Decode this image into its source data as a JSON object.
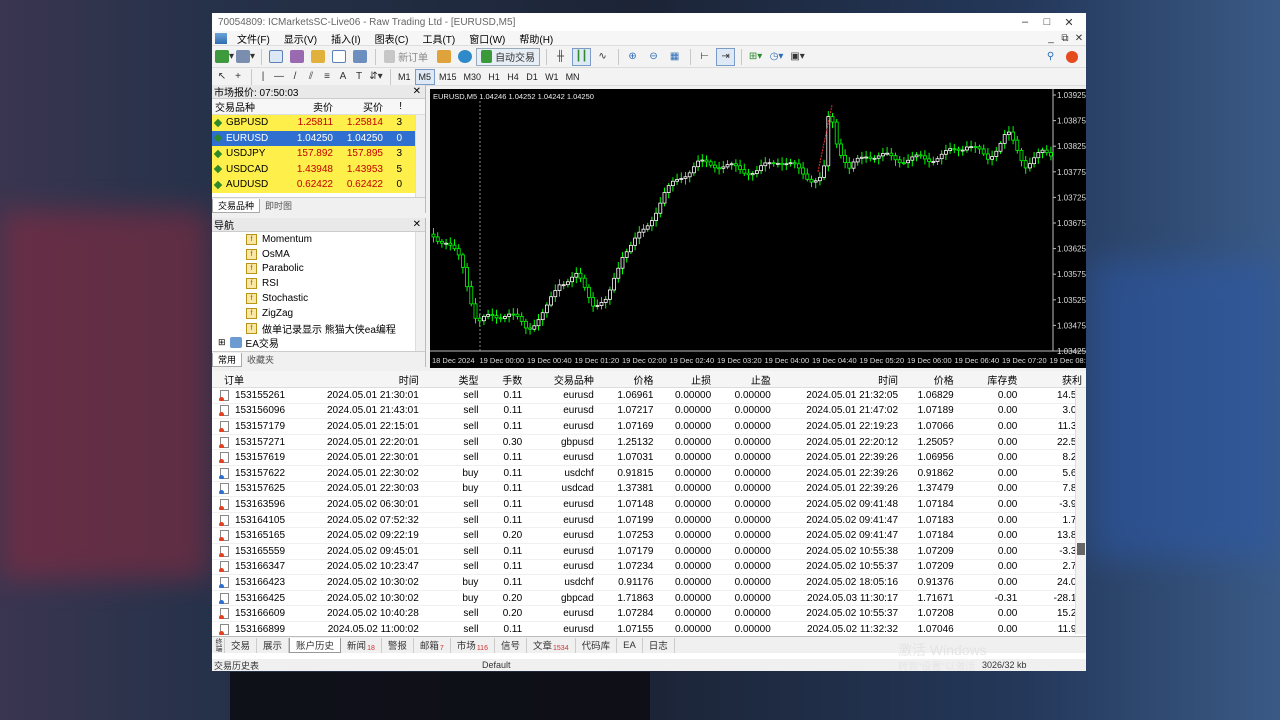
{
  "window": {
    "title": "70054809: ICMarketsSC-Live06 - Raw Trading Ltd - [EURUSD,M5]"
  },
  "menu": [
    "文件(F)",
    "显示(V)",
    "插入(I)",
    "图表(C)",
    "工具(T)",
    "窗口(W)",
    "帮助(H)"
  ],
  "toolbar": {
    "new_order": "新订单",
    "auto_trading": "自动交易",
    "timeframes": [
      "M1",
      "M5",
      "M15",
      "M30",
      "H1",
      "H4",
      "D1",
      "W1",
      "MN"
    ],
    "active_timeframe": "M5"
  },
  "market_watch": {
    "title": "市场报价: 07:50:03",
    "headers": {
      "symbol": "交易品种",
      "bid": "卖价",
      "ask": "买价",
      "spread": "!"
    },
    "rows": [
      {
        "symbol": "GBPUSD",
        "bid": "1.25811",
        "ask": "1.25814",
        "spread": "3"
      },
      {
        "symbol": "EURUSD",
        "bid": "1.04250",
        "ask": "1.04250",
        "spread": "0"
      },
      {
        "symbol": "USDJPY",
        "bid": "157.892",
        "ask": "157.895",
        "spread": "3"
      },
      {
        "symbol": "USDCAD",
        "bid": "1.43948",
        "ask": "1.43953",
        "spread": "5"
      },
      {
        "symbol": "AUDUSD",
        "bid": "0.62422",
        "ask": "0.62422",
        "spread": "0"
      }
    ],
    "tabs": [
      "交易品种",
      "即时图"
    ]
  },
  "navigator": {
    "title": "导航",
    "indicators": [
      "Momentum",
      "OsMA",
      "Parabolic",
      "RSI",
      "Stochastic",
      "ZigZag",
      "做单记录显示 熊猫大侠ea编程"
    ],
    "ea_label": "EA交易",
    "tabs": [
      "常用",
      "收藏夹"
    ]
  },
  "chart": {
    "label": "EURUSD,M5  1.04246 1.04252 1.04242 1.04250",
    "price_levels": [
      "1.03925",
      "1.03875",
      "1.03825",
      "1.03775",
      "1.03725",
      "1.03675",
      "1.03625",
      "1.03575",
      "1.03525",
      "1.03475",
      "1.03425"
    ],
    "time_labels": [
      "18 Dec 2024",
      "19 Dec 00:00",
      "19 Dec 00:40",
      "19 Dec 01:20",
      "19 Dec 02:00",
      "19 Dec 02:40",
      "19 Dec 03:20",
      "19 Dec 04:00",
      "19 Dec 04:40",
      "19 Dec 05:20",
      "19 Dec 06:00",
      "19 Dec 06:40",
      "19 Dec 07:20",
      "19 Dec 08:00"
    ],
    "colors": {
      "background": "#000000",
      "bull": "#ffffff",
      "bear": "#00ff00"
    }
  },
  "history": {
    "headers": [
      "订单",
      "时间",
      "类型",
      "手数",
      "交易品种",
      "价格",
      "止损",
      "止盈",
      "时间",
      "价格",
      "库存费",
      "获利"
    ],
    "rows": [
      [
        "153155261",
        "2024.05.01 21:30:01",
        "sell",
        "0.11",
        "eurusd",
        "1.06961",
        "0.00000",
        "0.00000",
        "2024.05.01 21:32:05",
        "1.06829",
        "0.00",
        "14.52"
      ],
      [
        "153156096",
        "2024.05.01 21:43:01",
        "sell",
        "0.11",
        "eurusd",
        "1.07217",
        "0.00000",
        "0.00000",
        "2024.05.01 21:47:02",
        "1.07189",
        "0.00",
        "3.08"
      ],
      [
        "153157179",
        "2024.05.01 22:15:01",
        "sell",
        "0.11",
        "eurusd",
        "1.07169",
        "0.00000",
        "0.00000",
        "2024.05.01 22:19:23",
        "1.07066",
        "0.00",
        "11.33"
      ],
      [
        "153157271",
        "2024.05.01 22:20:01",
        "sell",
        "0.30",
        "gbpusd",
        "1.25132",
        "0.00000",
        "0.00000",
        "2024.05.01 22:20:12",
        "1.2505?",
        "0.00",
        "22.50"
      ],
      [
        "153157619",
        "2024.05.01 22:30:01",
        "sell",
        "0.11",
        "eurusd",
        "1.07031",
        "0.00000",
        "0.00000",
        "2024.05.01 22:39:26",
        "1.06956",
        "0.00",
        "8.25"
      ],
      [
        "153157622",
        "2024.05.01 22:30:02",
        "buy",
        "0.11",
        "usdchf",
        "0.91815",
        "0.00000",
        "0.00000",
        "2024.05.01 22:39:26",
        "0.91862",
        "0.00",
        "5.63"
      ],
      [
        "153157625",
        "2024.05.01 22:30:03",
        "buy",
        "0.11",
        "usdcad",
        "1.37381",
        "0.00000",
        "0.00000",
        "2024.05.01 22:39:26",
        "1.37479",
        "0.00",
        "7.84"
      ],
      [
        "153163596",
        "2024.05.02 06:30:01",
        "sell",
        "0.11",
        "eurusd",
        "1.07148",
        "0.00000",
        "0.00000",
        "2024.05.02 09:41:48",
        "1.07184",
        "0.00",
        "-3.96"
      ],
      [
        "153164105",
        "2024.05.02 07:52:32",
        "sell",
        "0.11",
        "eurusd",
        "1.07199",
        "0.00000",
        "0.00000",
        "2024.05.02 09:41:47",
        "1.07183",
        "0.00",
        "1.76"
      ],
      [
        "153165165",
        "2024.05.02 09:22:19",
        "sell",
        "0.20",
        "eurusd",
        "1.07253",
        "0.00000",
        "0.00000",
        "2024.05.02 09:41:47",
        "1.07184",
        "0.00",
        "13.80"
      ],
      [
        "153165559",
        "2024.05.02 09:45:01",
        "sell",
        "0.11",
        "eurusd",
        "1.07179",
        "0.00000",
        "0.00000",
        "2024.05.02 10:55:38",
        "1.07209",
        "0.00",
        "-3.30"
      ],
      [
        "153166347",
        "2024.05.02 10:23:47",
        "sell",
        "0.11",
        "eurusd",
        "1.07234",
        "0.00000",
        "0.00000",
        "2024.05.02 10:55:37",
        "1.07209",
        "0.00",
        "2.75"
      ],
      [
        "153166423",
        "2024.05.02 10:30:02",
        "buy",
        "0.11",
        "usdchf",
        "0.91176",
        "0.00000",
        "0.00000",
        "2024.05.02 18:05:16",
        "0.91376",
        "0.00",
        "24.08"
      ],
      [
        "153166425",
        "2024.05.02 10:30:02",
        "buy",
        "0.20",
        "gbpcad",
        "1.71863",
        "0.00000",
        "0.00000",
        "2024.05.03 11:30:17",
        "1.71671",
        "-0.31",
        "-28.10"
      ],
      [
        "153166609",
        "2024.05.02 10:40:28",
        "sell",
        "0.20",
        "eurusd",
        "1.07284",
        "0.00000",
        "0.00000",
        "2024.05.02 10:55:37",
        "1.07208",
        "0.00",
        "15.20"
      ],
      [
        "153166899",
        "2024.05.02 11:00:02",
        "sell",
        "0.11",
        "eurusd",
        "1.07155",
        "0.00000",
        "0.00000",
        "2024.05.02 11:32:32",
        "1.07046",
        "0.00",
        "11.99"
      ]
    ]
  },
  "bottom_tabs": [
    {
      "label": "交易",
      "count": ""
    },
    {
      "label": "展示",
      "count": ""
    },
    {
      "label": "账户历史",
      "count": ""
    },
    {
      "label": "新闻",
      "count": "18"
    },
    {
      "label": "警报",
      "count": ""
    },
    {
      "label": "邮箱",
      "count": "7"
    },
    {
      "label": "市场",
      "count": "116"
    },
    {
      "label": "信号",
      "count": ""
    },
    {
      "label": "文章",
      "count": "1534"
    },
    {
      "label": "代码库",
      "count": ""
    },
    {
      "label": "EA",
      "count": ""
    },
    {
      "label": "日志",
      "count": ""
    }
  ],
  "status": {
    "left": "交易历史表",
    "profile": "Default",
    "traffic": "3026/32 kb"
  },
  "watermark": {
    "line1": "激活 Windows",
    "line2": "转到\"设置\"以激活"
  }
}
